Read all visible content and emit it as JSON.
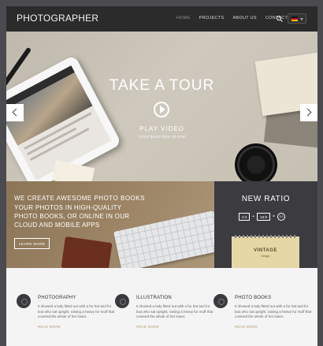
{
  "header": {
    "logo": "PHOTOGRAPHER",
    "nav": [
      {
        "label": "HOME",
        "active": true
      },
      {
        "label": "PROJECTS",
        "active": false
      },
      {
        "label": "ABOUT US",
        "active": false
      },
      {
        "label": "CONTACT",
        "active": false
      }
    ],
    "search_icon": "search-icon",
    "language_flag": "german-flag"
  },
  "hero": {
    "title": "TAKE A TOUR",
    "play_label": "PLAY VIDEO",
    "play_sub": "Lorem ipsum dolor sit amet"
  },
  "promo": {
    "title": "WE CREATE AWESOME PHOTO BOOKS",
    "text": "YOUR PHOTOS IN HIGH-QUALITY PHOTO BOOKS, OR ONLINE IN OUR CLOUD AND MOBILE APPS",
    "learn_more": "LEARN MORE"
  },
  "ratio": {
    "title": "NEW RATIO",
    "box1": "4:3",
    "plus1": "+",
    "box2": "16:9",
    "equals": "=",
    "circle": "3:2",
    "vintage_label": "VINTAGE",
    "vintage_sub": "Design"
  },
  "services": [
    {
      "title": "PHOTOGRAPHY",
      "desc": "It showed a lady fitted out with a fur hat and fur boa who sat upright, raising a heavy fur muff that covered the whole of her lower.",
      "more": "READ MORE"
    },
    {
      "title": "ILLUSTRATION",
      "desc": "It showed a lady fitted out with a fur hat and fur boa who sat upright, raising a heavy fur muff that covered the whole of her lower.",
      "more": "READ MORE"
    },
    {
      "title": "PHOTO BOOKS",
      "desc": "It showed a lady fitted out with a fur hat and fur boa who sat upright, raising a heavy fur muff that covered the whole of her lower.",
      "more": "READ MORE"
    }
  ]
}
